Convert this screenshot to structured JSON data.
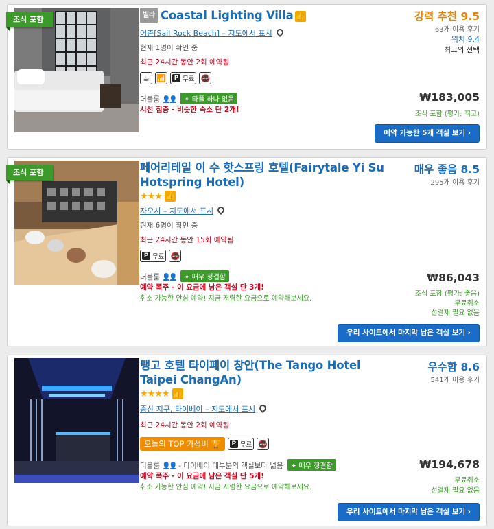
{
  "hotels": [
    {
      "ribbon": "조식 포함",
      "tag": "빌라",
      "name": "Coastal Lighting Villa",
      "location": "어촌[Sail Rock Beach] – 지도에서 표시",
      "viewers": "현재 1명이 확인 중",
      "recent": "최근 24시간 동안 2회 예약됨",
      "amenity_parking": "무료",
      "room_type": "더블룸",
      "badge": "타플 하나 없음",
      "alert": "시선 집중 - 비슷한 숙소 단 2개!",
      "rating_label": "강력 추천 9.5",
      "reviews": "63개 이용 후기",
      "location_score": "위치 9.4",
      "best_choice": "최고의 선택",
      "price": "₩183,005",
      "breakfast": "조식 포함 (평가: 최고)",
      "button": "예약 가능한 5개 객실 보기"
    },
    {
      "ribbon": "조식 포함",
      "name": "페어리테일 이 수 핫스프링 호텔(Fairytale Yi Su Hotspring Hotel)",
      "stars": "★★★",
      "location": "자오시 – 지도에서 표시",
      "viewers": "현재 6명이 확인 중",
      "recent": "최근 24시간 동안 15회 예약됨",
      "amenity_parking": "무료",
      "room_type": "더블룸",
      "badge": "매우 청결함",
      "alert": "예약 폭주 - 이 요금에 남은 객실 단 3개!",
      "cancel_note": "취소 가능한 안심 예약! 지금 저렴한 요금으로 예약해보세요.",
      "rating_label": "매우 좋음 8.5",
      "reviews": "295개 이용 후기",
      "price": "₩86,043",
      "breakfast": "조식 포함 (평가: 좋음)",
      "free_cancel": "무료취소",
      "no_prepay": "선결제 필요 없음",
      "button": "우리 사이트에서 마지막 남은 객실 보기"
    },
    {
      "name": "탱고 호텔 타이페이 창안(The Tango Hotel Taipei ChangAn)",
      "stars": "★★★★",
      "location": "중산 지구, 타이베이 – 지도에서 표시",
      "recent": "최근 24시간 동안 2회 예약됨",
      "top_value": "오늘의 TOP 가성비",
      "amenity_parking": "무료",
      "room_type": "더블룸",
      "room_extra": "- 타이베이 대부분의 객실보다 넓음",
      "badge": "매우 청결함",
      "alert": "예약 폭주 - 이 요금에 남은 객실 단 5개!",
      "cancel_note": "취소 가능한 안심 예약! 지금 저렴한 요금으로 예약해보세요.",
      "rating_label": "우수함 8.6",
      "reviews": "541개 이용 후기",
      "price": "₩194,678",
      "free_cancel": "무료취소",
      "no_prepay": "선결제 필요 없음",
      "button": "우리 사이트에서 마지막 남은 객실 보기"
    }
  ],
  "icons": {
    "thumb": "thumbs-up-icon",
    "pin": "map-pin-icon",
    "parking": "P",
    "no_smoking": "no-smoking-icon",
    "people": "people-icon",
    "arrow": "›"
  },
  "colors": {
    "link": "#1a6cb8",
    "ribbon_green": "#3c9a2a",
    "alert_red": "#d0021b",
    "rating_orange": "#e0880c",
    "button_blue": "#1a6cc6"
  }
}
